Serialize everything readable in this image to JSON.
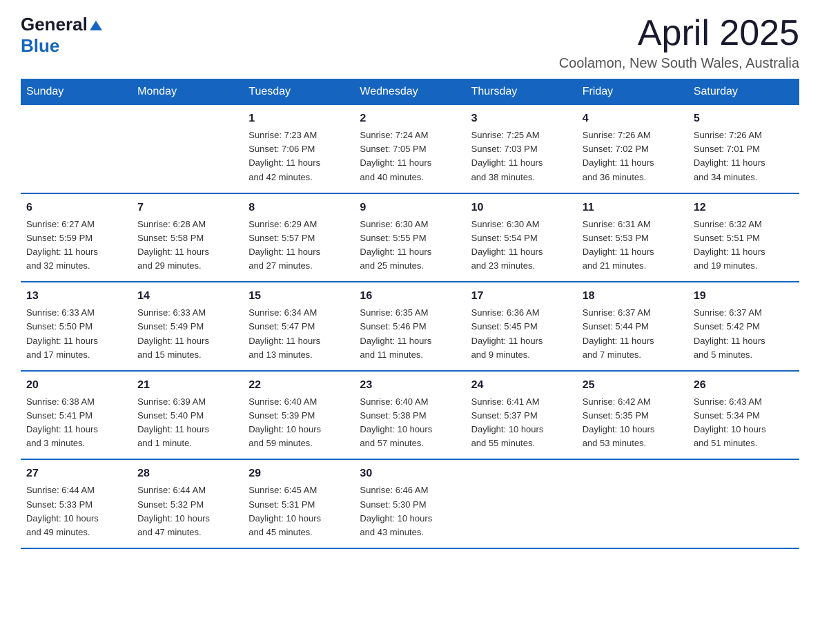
{
  "logo": {
    "general": "General",
    "blue": "Blue",
    "icon": "▲"
  },
  "title": {
    "month_year": "April 2025",
    "location": "Coolamon, New South Wales, Australia"
  },
  "calendar": {
    "headers": [
      "Sunday",
      "Monday",
      "Tuesday",
      "Wednesday",
      "Thursday",
      "Friday",
      "Saturday"
    ],
    "rows": [
      [
        {
          "day": "",
          "info": ""
        },
        {
          "day": "",
          "info": ""
        },
        {
          "day": "1",
          "info": "Sunrise: 7:23 AM\nSunset: 7:06 PM\nDaylight: 11 hours\nand 42 minutes."
        },
        {
          "day": "2",
          "info": "Sunrise: 7:24 AM\nSunset: 7:05 PM\nDaylight: 11 hours\nand 40 minutes."
        },
        {
          "day": "3",
          "info": "Sunrise: 7:25 AM\nSunset: 7:03 PM\nDaylight: 11 hours\nand 38 minutes."
        },
        {
          "day": "4",
          "info": "Sunrise: 7:26 AM\nSunset: 7:02 PM\nDaylight: 11 hours\nand 36 minutes."
        },
        {
          "day": "5",
          "info": "Sunrise: 7:26 AM\nSunset: 7:01 PM\nDaylight: 11 hours\nand 34 minutes."
        }
      ],
      [
        {
          "day": "6",
          "info": "Sunrise: 6:27 AM\nSunset: 5:59 PM\nDaylight: 11 hours\nand 32 minutes."
        },
        {
          "day": "7",
          "info": "Sunrise: 6:28 AM\nSunset: 5:58 PM\nDaylight: 11 hours\nand 29 minutes."
        },
        {
          "day": "8",
          "info": "Sunrise: 6:29 AM\nSunset: 5:57 PM\nDaylight: 11 hours\nand 27 minutes."
        },
        {
          "day": "9",
          "info": "Sunrise: 6:30 AM\nSunset: 5:55 PM\nDaylight: 11 hours\nand 25 minutes."
        },
        {
          "day": "10",
          "info": "Sunrise: 6:30 AM\nSunset: 5:54 PM\nDaylight: 11 hours\nand 23 minutes."
        },
        {
          "day": "11",
          "info": "Sunrise: 6:31 AM\nSunset: 5:53 PM\nDaylight: 11 hours\nand 21 minutes."
        },
        {
          "day": "12",
          "info": "Sunrise: 6:32 AM\nSunset: 5:51 PM\nDaylight: 11 hours\nand 19 minutes."
        }
      ],
      [
        {
          "day": "13",
          "info": "Sunrise: 6:33 AM\nSunset: 5:50 PM\nDaylight: 11 hours\nand 17 minutes."
        },
        {
          "day": "14",
          "info": "Sunrise: 6:33 AM\nSunset: 5:49 PM\nDaylight: 11 hours\nand 15 minutes."
        },
        {
          "day": "15",
          "info": "Sunrise: 6:34 AM\nSunset: 5:47 PM\nDaylight: 11 hours\nand 13 minutes."
        },
        {
          "day": "16",
          "info": "Sunrise: 6:35 AM\nSunset: 5:46 PM\nDaylight: 11 hours\nand 11 minutes."
        },
        {
          "day": "17",
          "info": "Sunrise: 6:36 AM\nSunset: 5:45 PM\nDaylight: 11 hours\nand 9 minutes."
        },
        {
          "day": "18",
          "info": "Sunrise: 6:37 AM\nSunset: 5:44 PM\nDaylight: 11 hours\nand 7 minutes."
        },
        {
          "day": "19",
          "info": "Sunrise: 6:37 AM\nSunset: 5:42 PM\nDaylight: 11 hours\nand 5 minutes."
        }
      ],
      [
        {
          "day": "20",
          "info": "Sunrise: 6:38 AM\nSunset: 5:41 PM\nDaylight: 11 hours\nand 3 minutes."
        },
        {
          "day": "21",
          "info": "Sunrise: 6:39 AM\nSunset: 5:40 PM\nDaylight: 11 hours\nand 1 minute."
        },
        {
          "day": "22",
          "info": "Sunrise: 6:40 AM\nSunset: 5:39 PM\nDaylight: 10 hours\nand 59 minutes."
        },
        {
          "day": "23",
          "info": "Sunrise: 6:40 AM\nSunset: 5:38 PM\nDaylight: 10 hours\nand 57 minutes."
        },
        {
          "day": "24",
          "info": "Sunrise: 6:41 AM\nSunset: 5:37 PM\nDaylight: 10 hours\nand 55 minutes."
        },
        {
          "day": "25",
          "info": "Sunrise: 6:42 AM\nSunset: 5:35 PM\nDaylight: 10 hours\nand 53 minutes."
        },
        {
          "day": "26",
          "info": "Sunrise: 6:43 AM\nSunset: 5:34 PM\nDaylight: 10 hours\nand 51 minutes."
        }
      ],
      [
        {
          "day": "27",
          "info": "Sunrise: 6:44 AM\nSunset: 5:33 PM\nDaylight: 10 hours\nand 49 minutes."
        },
        {
          "day": "28",
          "info": "Sunrise: 6:44 AM\nSunset: 5:32 PM\nDaylight: 10 hours\nand 47 minutes."
        },
        {
          "day": "29",
          "info": "Sunrise: 6:45 AM\nSunset: 5:31 PM\nDaylight: 10 hours\nand 45 minutes."
        },
        {
          "day": "30",
          "info": "Sunrise: 6:46 AM\nSunset: 5:30 PM\nDaylight: 10 hours\nand 43 minutes."
        },
        {
          "day": "",
          "info": ""
        },
        {
          "day": "",
          "info": ""
        },
        {
          "day": "",
          "info": ""
        }
      ]
    ]
  }
}
